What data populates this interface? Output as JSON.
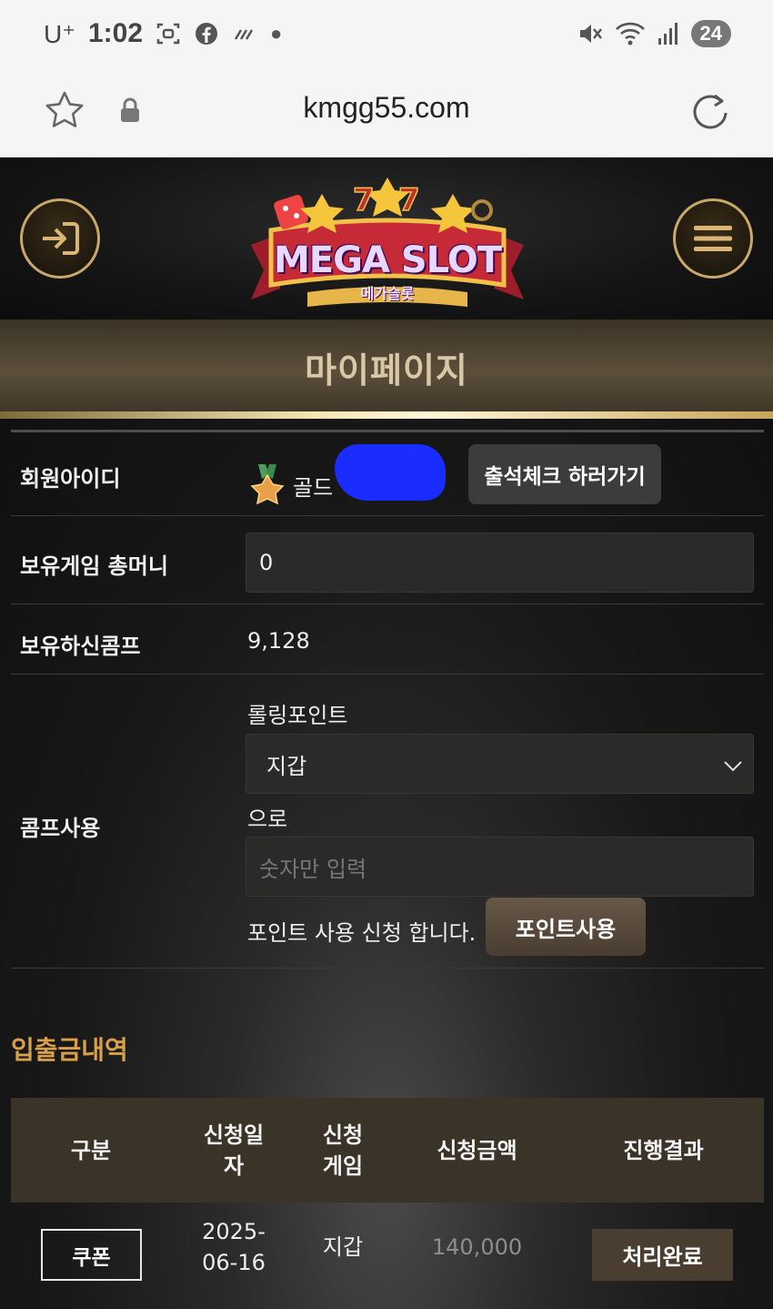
{
  "status_bar": {
    "carrier": "U⁺",
    "time": "1:02",
    "battery": "24",
    "icons": [
      "screenshot-icon",
      "facebook-icon",
      "data-icon",
      "dot-icon",
      "mute-icon",
      "wifi-icon",
      "signal-icon"
    ]
  },
  "browser": {
    "url": "kmgg55.com",
    "icons": [
      "star-icon",
      "lock-icon",
      "reload-icon"
    ]
  },
  "header": {
    "logo_text": "MEGA SLOT",
    "logo_sub": "메가슬롯",
    "login_icon": "login-icon",
    "menu_icon": "hamburger-icon",
    "accent_color": "#c9a86a"
  },
  "page": {
    "title": "마이페이지"
  },
  "form": {
    "member_id_label": "회원아이디",
    "member_grade": "골드",
    "attendance_button": "출석체크 하러가기",
    "game_money_label": "보유게임 총머니",
    "game_money_value": "0",
    "comp_label": "보유하신콤프",
    "comp_value": "9,128",
    "comp_use_label": "콤프사용",
    "rolling_point_label": "롤링포인트",
    "target_selected": "지갑",
    "to_label": "으로",
    "amount_placeholder": "숫자만 입력",
    "apply_text": "포인트 사용 신청 합니다.",
    "point_button": "포인트사용"
  },
  "history": {
    "title": "입출금내역",
    "title_color": "#d9a04a",
    "columns": [
      "구분",
      "신청일\n자",
      "신청\n게임",
      "신청금액",
      "진행결과"
    ],
    "rows": [
      {
        "type": "쿠폰",
        "date": "2025-\n06-16",
        "game": "지갑",
        "amount": "140,000",
        "result": "처리완료"
      }
    ]
  }
}
